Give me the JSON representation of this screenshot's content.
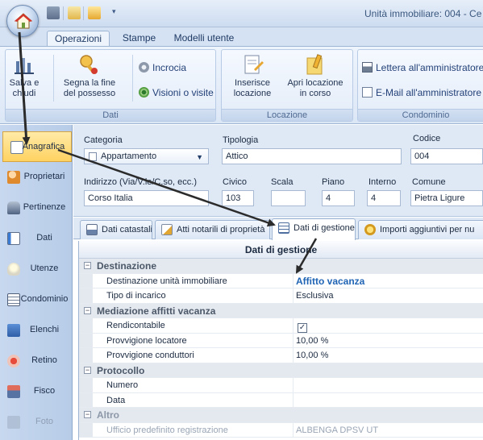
{
  "window": {
    "title": "Unità immobiliare: 004 - Ce"
  },
  "quick_access": {
    "dropdown_glyph": "▾"
  },
  "ribbon_tabs": [
    "Operazioni",
    "Stampe",
    "Modelli utente"
  ],
  "ribbon": {
    "groups": {
      "dati": "Dati",
      "locazione": "Locazione",
      "condominio": "Condominio"
    },
    "salva_line1": "Salva e",
    "salva_line2": "chiudi",
    "segna_line1": "Segna la fine",
    "segna_line2": "del possesso",
    "incrocia": "Incrocia",
    "visioni": "Visioni o visite",
    "inserisce_line1": "Inserisce",
    "inserisce_line2": "locazione",
    "apri_line1": "Apri locazione",
    "apri_line2": "in corso",
    "lettera": "Lettera all'amministratore",
    "email": "E-Mail all'amministratore"
  },
  "nav": [
    {
      "label": "Anagrafica",
      "icon": "edit-card-icon"
    },
    {
      "label": "Proprietari",
      "icon": "people-icon"
    },
    {
      "label": "Pertinenze",
      "icon": "car-icon"
    },
    {
      "label": "Dati",
      "icon": "notepad-icon"
    },
    {
      "label": "Utenze",
      "icon": "lightbulb-icon"
    },
    {
      "label": "Condominio",
      "icon": "building-list-icon"
    },
    {
      "label": "Elenchi",
      "icon": "list-icon"
    },
    {
      "label": "Retino",
      "icon": "gear-icon"
    },
    {
      "label": "Fisco",
      "icon": "calculator-icon"
    },
    {
      "label": "Foto",
      "icon": "camera-icon"
    }
  ],
  "header": {
    "categoria_label": "Categoria",
    "categoria_value": "Appartamento",
    "tipologia_label": "Tipologia",
    "tipologia_value": "Attico",
    "codice_label": "Codice",
    "codice_value": "004",
    "indirizzo_label": "Indirizzo (Via/V.le/C.so, ecc.)",
    "indirizzo_value": "Corso Italia",
    "civico_label": "Civico",
    "civico_value": "103",
    "scala_label": "Scala",
    "scala_value": "",
    "piano_label": "Piano",
    "piano_value": "4",
    "interno_label": "Interno",
    "interno_value": "4",
    "comune_label": "Comune",
    "comune_value": "Pietra Ligure"
  },
  "content_tabs": [
    "Dati catastali",
    "Atti notarili di proprietà",
    "Dati di gestione",
    "Importi aggiuntivi per nu"
  ],
  "grid": {
    "title": "Dati di gestione",
    "destinazione": "Destinazione",
    "destinazione_unita": "Destinazione unità immobiliare",
    "destinazione_unita_val": "Affitto vacanza",
    "tipo_incarico": "Tipo di incarico",
    "tipo_incarico_val": "Esclusiva",
    "mediazione": "Mediazione affitti vacanza",
    "rendicontabile": "Rendicontabile",
    "rendicontabile_checked": true,
    "provv_locatore": "Provvigione locatore",
    "provv_locatore_val": "10,00 %",
    "provv_conduttori": "Provvigione conduttori",
    "provv_conduttori_val": "10,00 %",
    "protocollo": "Protocollo",
    "numero": "Numero",
    "numero_val": "",
    "data": "Data",
    "data_val": "",
    "altro": "Altro",
    "ufficio": "Ufficio predefinito registrazione",
    "ufficio_val": "ALBENGA DPSV UT"
  },
  "colors": {
    "accent": "#1f64b4",
    "active_nav": "#ffd261",
    "ribbon_bg": "#dce7f6"
  }
}
